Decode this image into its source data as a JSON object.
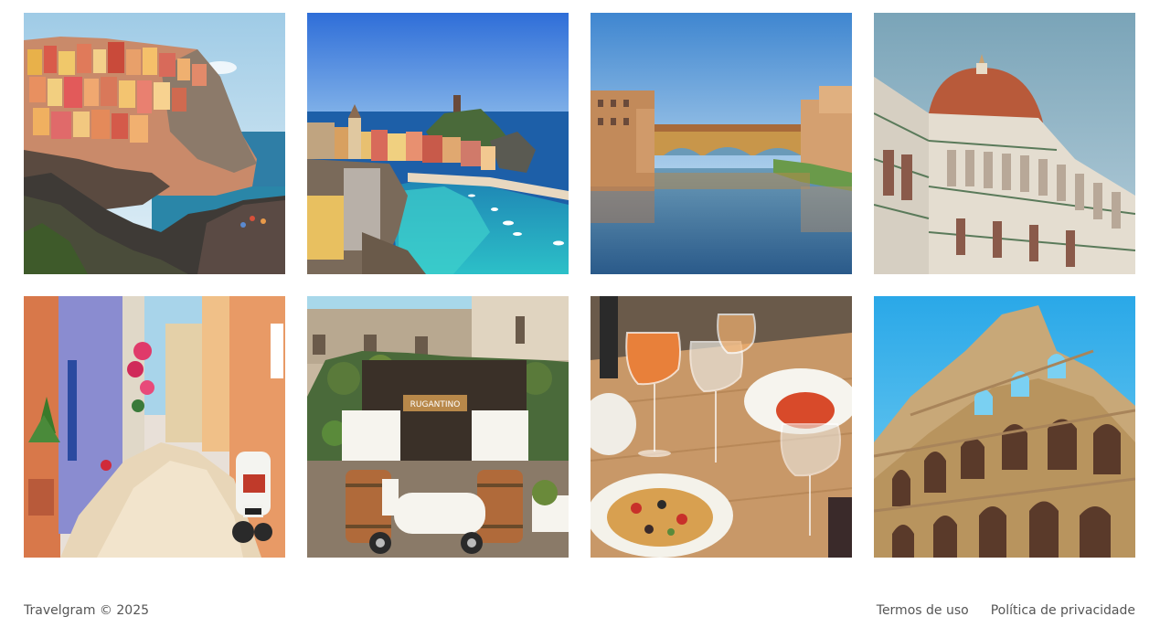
{
  "gallery": {
    "photos": [
      {
        "icon": "photo-manarola-cliffside-village"
      },
      {
        "icon": "photo-vernazza-harbor"
      },
      {
        "icon": "photo-ponte-vecchio-florence"
      },
      {
        "icon": "photo-florence-duomo"
      },
      {
        "icon": "photo-colorful-alley-with-vespa"
      },
      {
        "icon": "photo-rugantino-restaurant-vespa",
        "sign": "RUGANTINO"
      },
      {
        "icon": "photo-spritz-and-seafood-pasta"
      },
      {
        "icon": "photo-colosseum-rome"
      }
    ]
  },
  "footer": {
    "copyright": "Travelgram © 2025",
    "links": [
      {
        "label": "Termos de uso"
      },
      {
        "label": "Política de privacidade"
      }
    ],
    "text_color": "#555555"
  }
}
